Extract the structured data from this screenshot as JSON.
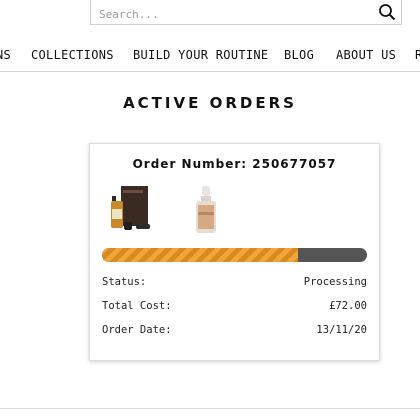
{
  "search": {
    "placeholder": "Search..."
  },
  "nav": {
    "items": [
      "NS",
      "COLLECTIONS",
      "BUILD YOUR ROUTINE",
      "BLOG",
      "ABOUT US",
      "R"
    ]
  },
  "page": {
    "title": "ACTIVE ORDERS"
  },
  "order": {
    "number_line": "Order Number: 250677057",
    "progress": 0.74,
    "status_label": "Status:",
    "status_value": "Processing",
    "total_label": "Total Cost:",
    "total_value": "£72.00",
    "date_label": "Order Date:",
    "date_value": "13/11/20"
  },
  "colors": {
    "progress_fill": "#f3a53d",
    "progress_track": "#555555"
  },
  "icons": {
    "search": "magnifier-icon"
  }
}
